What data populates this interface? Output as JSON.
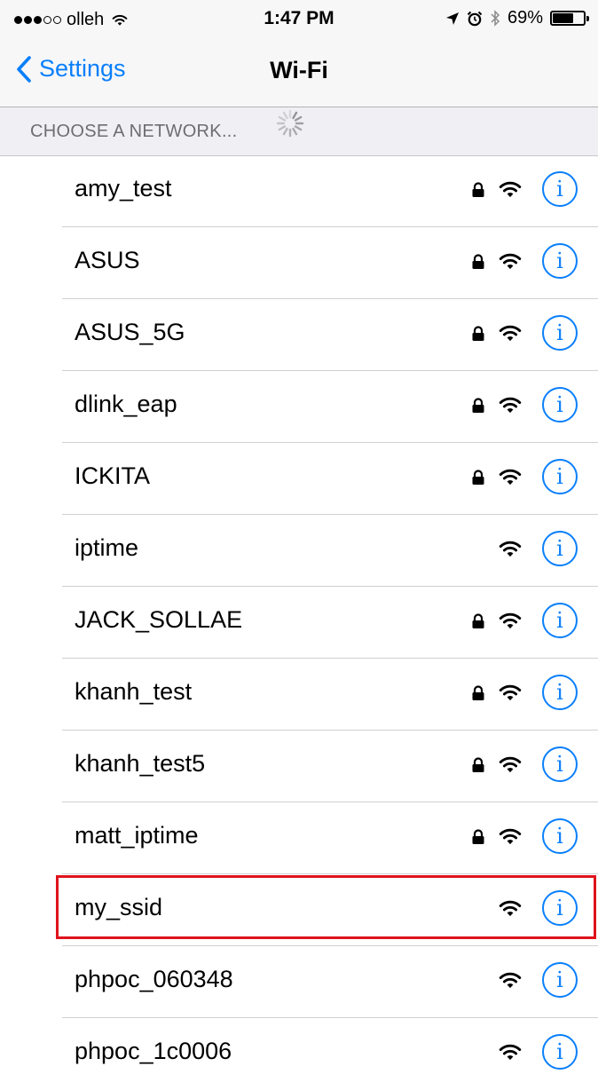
{
  "status_bar": {
    "signal_filled": 3,
    "signal_total": 5,
    "carrier": "olleh",
    "time": "1:47 PM",
    "battery_percent": "69%",
    "battery_level": 0.69,
    "icons": [
      "wifi-icon",
      "location-arrow-icon",
      "alarm-icon",
      "bluetooth-icon",
      "battery-icon"
    ]
  },
  "nav": {
    "back_label": "Settings",
    "title": "Wi-Fi"
  },
  "section": {
    "title": "CHOOSE A NETWORK..."
  },
  "networks": [
    {
      "ssid": "amy_test",
      "locked": true
    },
    {
      "ssid": "ASUS",
      "locked": true
    },
    {
      "ssid": "ASUS_5G",
      "locked": true
    },
    {
      "ssid": "dlink_eap",
      "locked": true
    },
    {
      "ssid": "ICKITA",
      "locked": true
    },
    {
      "ssid": "iptime",
      "locked": false
    },
    {
      "ssid": "JACK_SOLLAE",
      "locked": true
    },
    {
      "ssid": "khanh_test",
      "locked": true
    },
    {
      "ssid": "khanh_test5",
      "locked": true
    },
    {
      "ssid": "matt_iptime",
      "locked": true
    },
    {
      "ssid": "my_ssid",
      "locked": false,
      "highlighted": true
    },
    {
      "ssid": "phpoc_060348",
      "locked": false
    },
    {
      "ssid": "phpoc_1c0006",
      "locked": false
    }
  ],
  "info_glyph": "i",
  "colors": {
    "accent": "#0a7ffb",
    "highlight_border": "#e0131c",
    "section_bg": "#efeff4"
  }
}
